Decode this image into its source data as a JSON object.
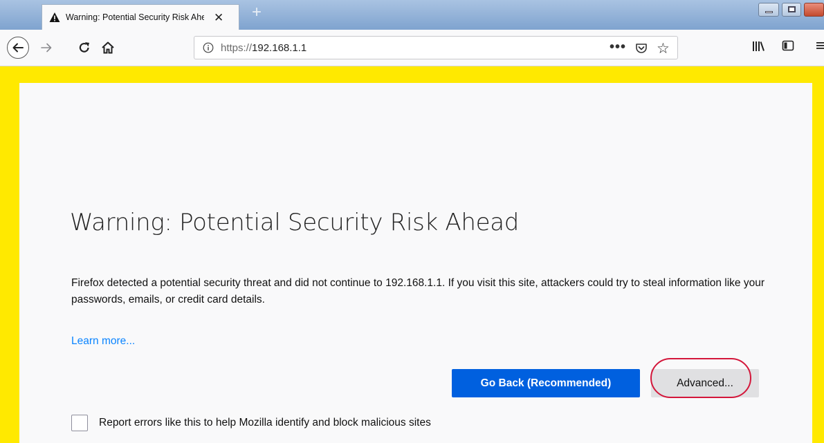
{
  "tab": {
    "title": "Warning: Potential Security Risk Ahead",
    "close_glyph": "✕",
    "icon": "warning-triangle-icon"
  },
  "newtab": {
    "glyph": "+"
  },
  "nav": {
    "url_scheme": "https://",
    "url_host": "192.168.1.1",
    "more_glyph": "•••",
    "star_glyph": "☆"
  },
  "page": {
    "title": "Warning: Potential Security Risk Ahead",
    "description": "Firefox detected a potential security threat and did not continue to 192.168.1.1. If you visit this site, attackers could try to steal information like your passwords, emails, or credit card details.",
    "learn_more": "Learn more...",
    "go_back_button": "Go Back (Recommended)",
    "advanced_button": "Advanced...",
    "report_checkbox_label": "Report errors like this to help Mozilla identify and block malicious sites",
    "report_checked": false
  },
  "colors": {
    "highlight_frame": "#ffe900",
    "primary_button": "#0060df",
    "link": "#0a84ff",
    "annotation_ring": "#d3163a"
  }
}
